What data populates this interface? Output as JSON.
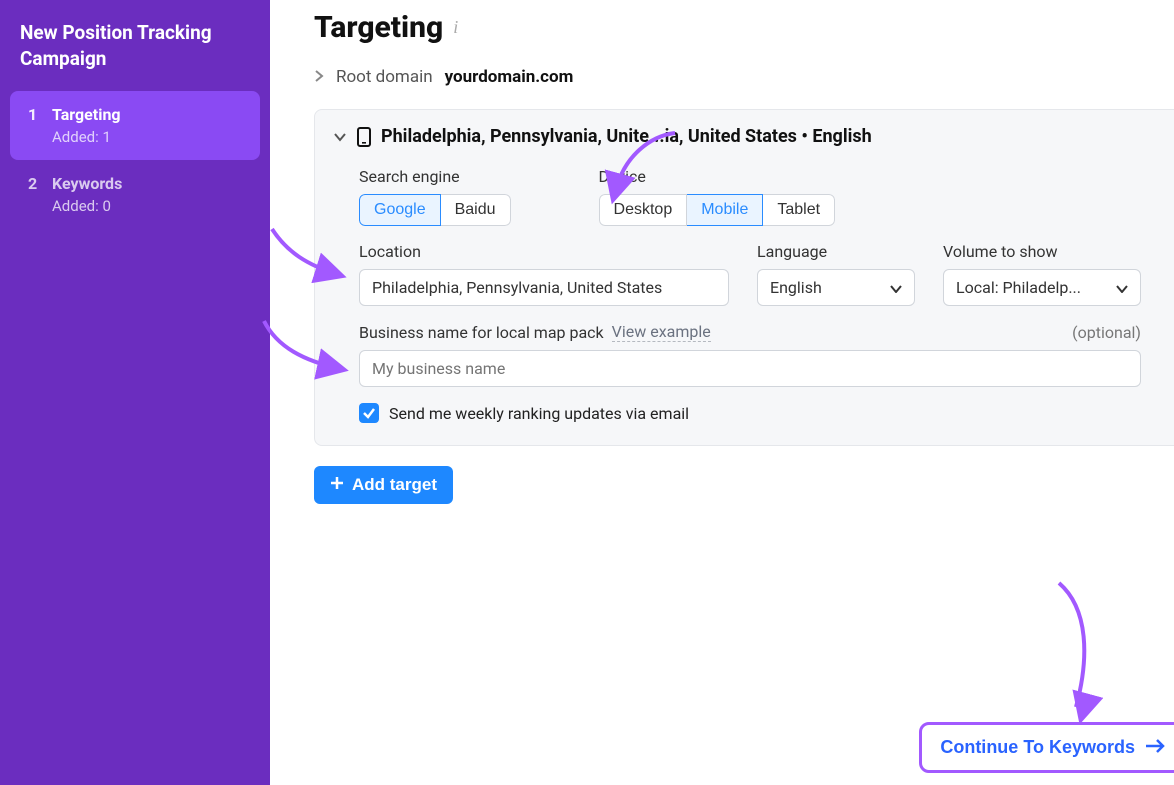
{
  "sidebar": {
    "title": "New Position Tracking Campaign",
    "steps": [
      {
        "num": "1",
        "label": "Targeting",
        "sub": "Added: 1",
        "active": true
      },
      {
        "num": "2",
        "label": "Keywords",
        "sub": "Added: 0",
        "active": false
      }
    ]
  },
  "page_title": "Targeting",
  "breadcrumb": {
    "label": "Root domain",
    "value": "yourdomain.com"
  },
  "target": {
    "header": "Philadelphia, Pennsylvania, Unite...ia, United States  •  English",
    "search_engine": {
      "label": "Search engine",
      "options": [
        "Google",
        "Baidu"
      ],
      "selected": "Google"
    },
    "device": {
      "label": "Device",
      "options": [
        "Desktop",
        "Mobile",
        "Tablet"
      ],
      "selected": "Mobile"
    },
    "location": {
      "label": "Location",
      "value": "Philadelphia, Pennsylvania, United States"
    },
    "language": {
      "label": "Language",
      "value": "English"
    },
    "volume": {
      "label": "Volume to show",
      "value": "Local: Philadelp..."
    },
    "business": {
      "label": "Business name for local map pack",
      "view_example": "View example",
      "optional": "(optional)",
      "placeholder": "My business name"
    },
    "weekly_cb": {
      "checked": true,
      "label": "Send me weekly ranking updates via email"
    }
  },
  "add_target_label": "Add target",
  "continue_label": "Continue To Keywords"
}
